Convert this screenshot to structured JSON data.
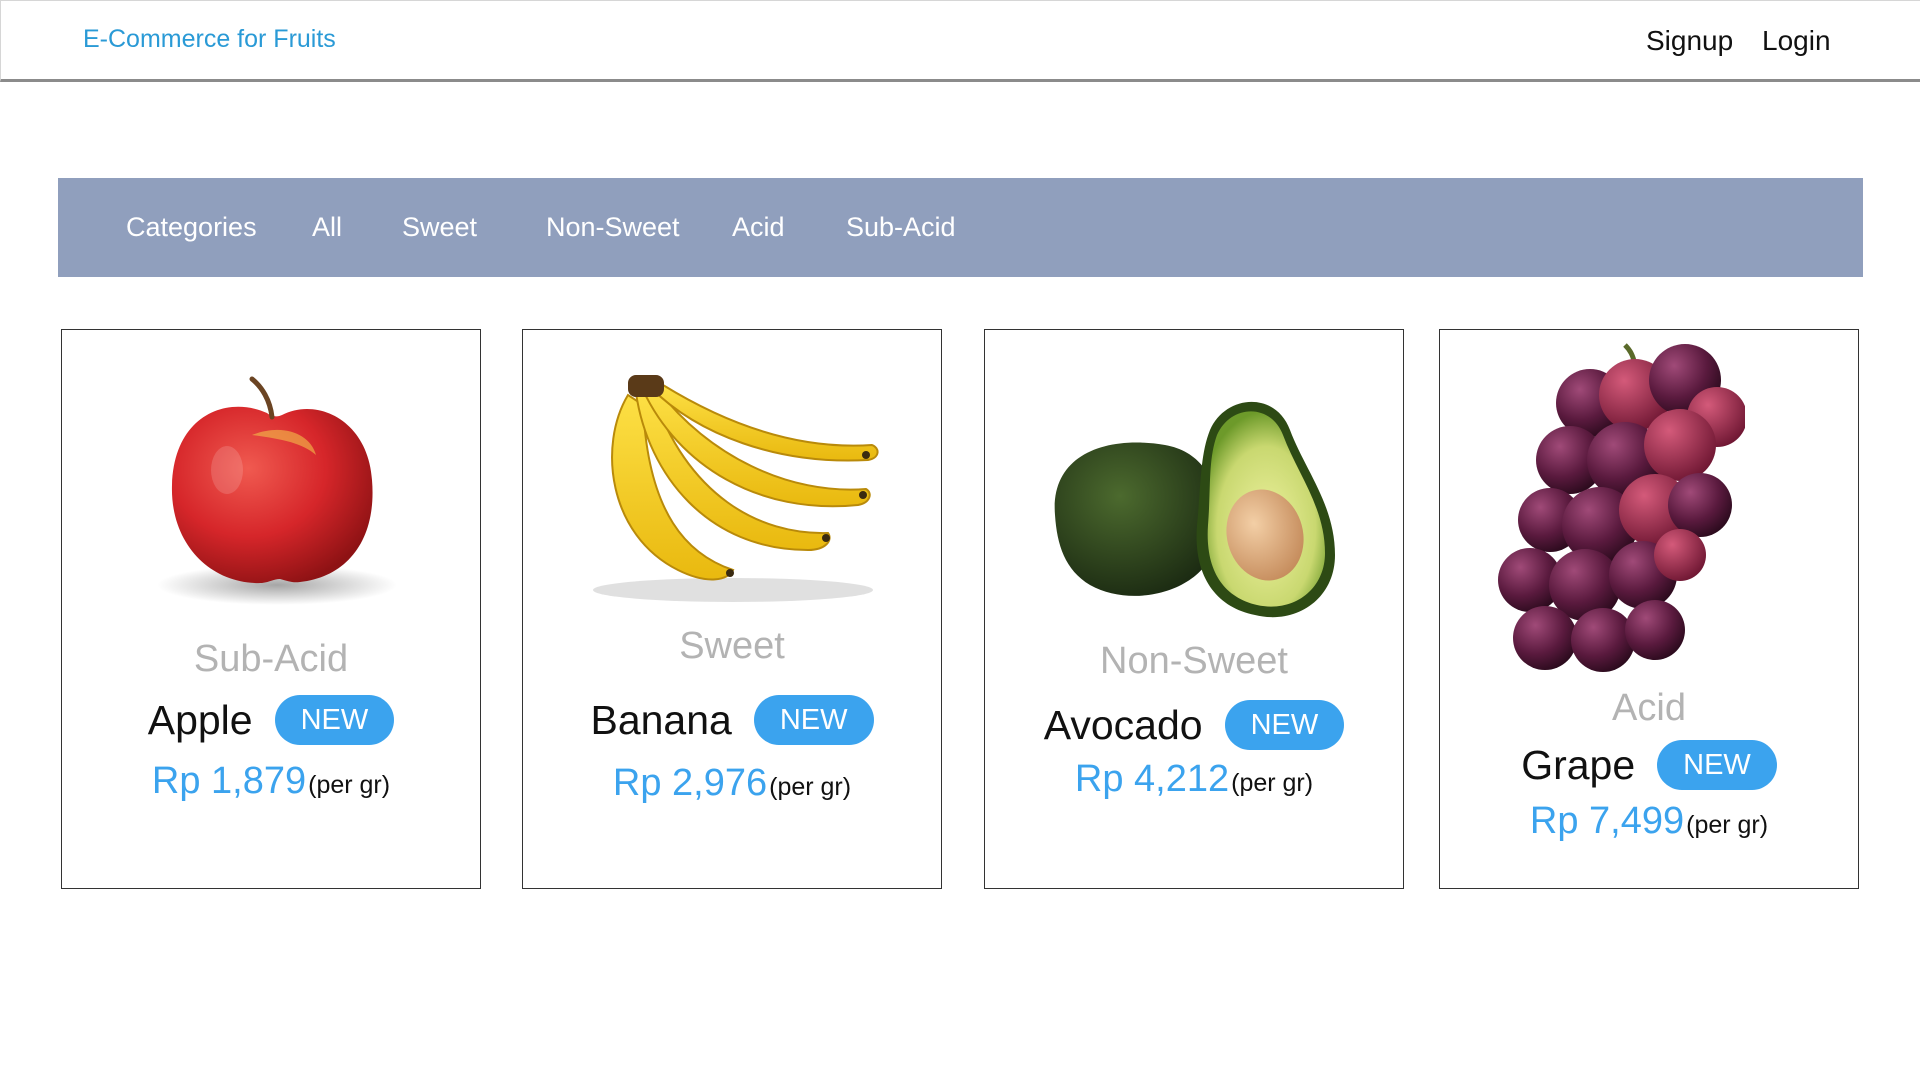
{
  "header": {
    "brand": "E-Commerce for Fruits",
    "signup": "Signup",
    "login": "Login"
  },
  "categories": {
    "heading": "Categories",
    "items": [
      "All",
      "Sweet",
      "Non-Sweet",
      "Acid",
      "Sub-Acid"
    ]
  },
  "products": [
    {
      "type": "Sub-Acid",
      "name": "Apple",
      "badge": "NEW",
      "price": "Rp 1,879",
      "unit": "(per gr)",
      "icon": "apple-icon"
    },
    {
      "type": "Sweet",
      "name": "Banana",
      "badge": "NEW",
      "price": "Rp 2,976",
      "unit": "(per gr)",
      "icon": "banana-icon"
    },
    {
      "type": "Non-Sweet",
      "name": "Avocado",
      "badge": "NEW",
      "price": "Rp 4,212",
      "unit": "(per gr)",
      "icon": "avocado-icon"
    },
    {
      "type": "Acid",
      "name": "Grape",
      "badge": "NEW",
      "price": "Rp 7,499",
      "unit": "(per gr)",
      "icon": "grape-icon"
    }
  ],
  "colors": {
    "accent": "#3ba3ee",
    "brand": "#2a9ad6",
    "category_bar": "#909fbd",
    "muted_text": "#b3b3b3"
  }
}
